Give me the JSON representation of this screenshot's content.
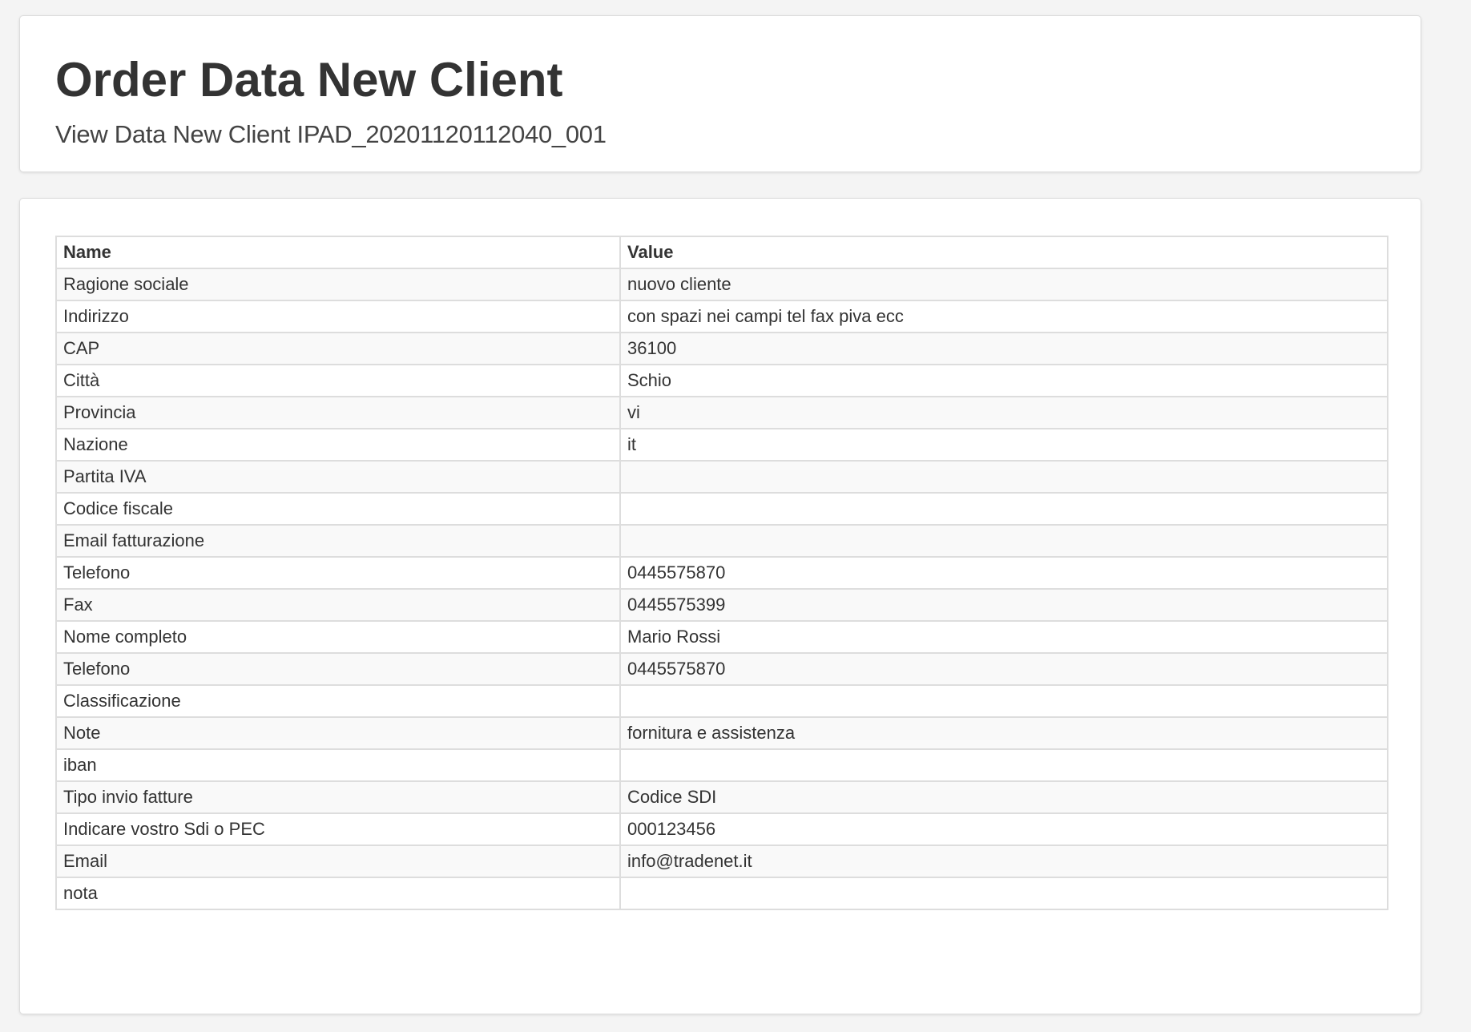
{
  "header": {
    "title": "Order Data New Client",
    "subtitle": "View Data New Client IPAD_20201120112040_001"
  },
  "table": {
    "columns": [
      "Name",
      "Value"
    ],
    "rows": [
      {
        "name": "Ragione sociale",
        "value": "nuovo cliente"
      },
      {
        "name": "Indirizzo",
        "value": "con spazi nei campi tel fax piva ecc"
      },
      {
        "name": "CAP",
        "value": "36100"
      },
      {
        "name": "Città",
        "value": "Schio"
      },
      {
        "name": "Provincia",
        "value": "vi"
      },
      {
        "name": "Nazione",
        "value": "it"
      },
      {
        "name": "Partita IVA",
        "value": ""
      },
      {
        "name": "Codice fiscale",
        "value": ""
      },
      {
        "name": "Email fatturazione",
        "value": ""
      },
      {
        "name": "Telefono",
        "value": "0445575870"
      },
      {
        "name": "Fax",
        "value": "0445575399"
      },
      {
        "name": "Nome completo",
        "value": "Mario Rossi"
      },
      {
        "name": "Telefono",
        "value": "0445575870"
      },
      {
        "name": "Classificazione",
        "value": ""
      },
      {
        "name": "Note",
        "value": "fornitura e assistenza"
      },
      {
        "name": "iban",
        "value": ""
      },
      {
        "name": "Tipo invio fatture",
        "value": "Codice SDI"
      },
      {
        "name": "Indicare vostro Sdi o PEC",
        "value": "000123456"
      },
      {
        "name": "Email",
        "value": "info@tradenet.it"
      },
      {
        "name": "nota",
        "value": ""
      }
    ]
  }
}
